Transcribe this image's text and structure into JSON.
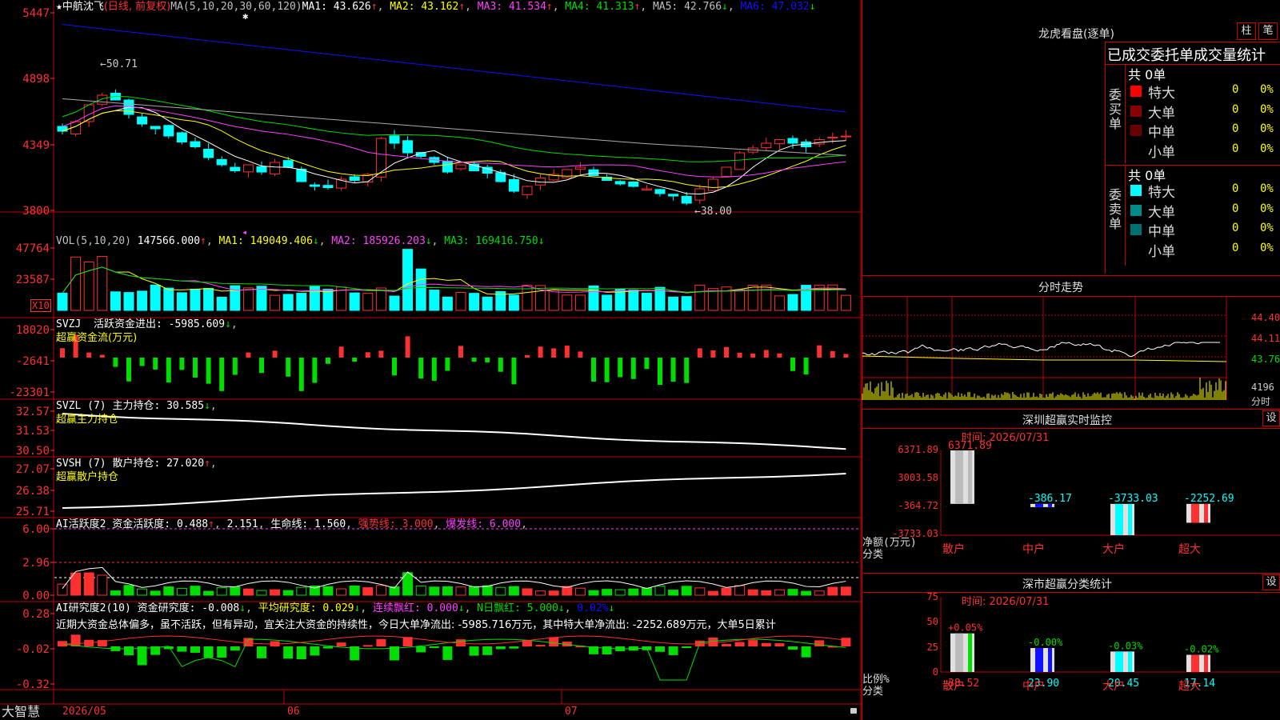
{
  "app": {
    "brand": "大智慧",
    "star": "★",
    "stock_name": "中航沈飞",
    "period_note": "(日线, 前复权)",
    "lock_icon": "lock-icon"
  },
  "colors": {
    "up": "#ff3030",
    "down": "#00ffff",
    "green": "#00dd00",
    "white": "#ffffff",
    "yellow": "#ffff00",
    "magenta": "#ff40ff",
    "blue": "#1010ff",
    "grid": "#c00000"
  },
  "kline": {
    "header_parts": [
      {
        "t": "MA(5,10,20,30,60,120)",
        "c": "#c0c0c0"
      },
      {
        "t": "MA1: 43.626",
        "c": "#ffffff"
      },
      {
        "t": "↑",
        "c": "#ff3030"
      },
      {
        "t": ", ",
        "c": "#c0c0c0"
      },
      {
        "t": "MA2: 43.162",
        "c": "#ffff00"
      },
      {
        "t": "↑",
        "c": "#ff3030"
      },
      {
        "t": ", ",
        "c": "#c0c0c0"
      },
      {
        "t": "MA3: 41.534",
        "c": "#ff40ff"
      },
      {
        "t": "↑",
        "c": "#ff3030"
      },
      {
        "t": ", ",
        "c": "#c0c0c0"
      },
      {
        "t": "MA4: 41.313",
        "c": "#00dd00"
      },
      {
        "t": "↑",
        "c": "#ff3030"
      },
      {
        "t": ", ",
        "c": "#c0c0c0"
      },
      {
        "t": "MA5: 42.766",
        "c": "#c0c0c0"
      },
      {
        "t": "↓",
        "c": "#00dd00"
      },
      {
        "t": ", ",
        "c": "#c0c0c0"
      },
      {
        "t": "MA6: 47.032",
        "c": "#1010ff"
      },
      {
        "t": "↓",
        "c": "#00dd00"
      }
    ],
    "y_ticks": [
      "5447",
      "4898",
      "4349",
      "3800"
    ],
    "high_label": "←50.71",
    "low_label": "←38.00",
    "highlight_marker": "✱",
    "tri_marker": "◂"
  },
  "x_axis": {
    "labels": [
      "2026/05",
      "06",
      "07"
    ]
  },
  "vol": {
    "header_parts": [
      {
        "t": "VOL(5,10,20) ",
        "c": "#c0c0c0"
      },
      {
        "t": "147566.000",
        "c": "#ffffff"
      },
      {
        "t": "↑",
        "c": "#ff3030"
      },
      {
        "t": ", ",
        "c": "#c0c0c0"
      },
      {
        "t": "MA1: 149049.406",
        "c": "#ffff00"
      },
      {
        "t": "↓",
        "c": "#00dd00"
      },
      {
        "t": ", ",
        "c": "#c0c0c0"
      },
      {
        "t": "MA2: 185926.203",
        "c": "#ff40ff"
      },
      {
        "t": "↓",
        "c": "#00dd00"
      },
      {
        "t": ", ",
        "c": "#c0c0c0"
      },
      {
        "t": "MA3: 169416.750",
        "c": "#00dd00"
      },
      {
        "t": "↓",
        "c": "#00dd00"
      }
    ],
    "y_ticks": [
      "47764",
      "23587"
    ],
    "unit": "X10"
  },
  "svzj": {
    "header_parts": [
      {
        "t": "SVZJ  活跃资金进出: -5985.609",
        "c": "#ffffff"
      },
      {
        "t": "↓",
        "c": "#00dd00"
      },
      {
        "t": ",",
        "c": "#c0c0c0"
      }
    ],
    "sub": "超赢资金流(万元)",
    "y_ticks": [
      "18020",
      "-2641",
      "-23301"
    ]
  },
  "svzl": {
    "header_parts": [
      {
        "t": "SVZL (7) 主力持仓: 30.585",
        "c": "#ffffff"
      },
      {
        "t": "↓",
        "c": "#00dd00"
      },
      {
        "t": ",",
        "c": "#c0c0c0"
      }
    ],
    "sub": "超赢主力持仓",
    "y_ticks": [
      "32.57",
      "31.53",
      "30.50"
    ]
  },
  "svsh": {
    "header_parts": [
      {
        "t": "SVSH (7) 散户持仓: 27.020",
        "c": "#ffffff"
      },
      {
        "t": "↑",
        "c": "#ff3030"
      },
      {
        "t": ",",
        "c": "#c0c0c0"
      }
    ],
    "sub": "超赢散户持仓",
    "y_ticks": [
      "27.07",
      "26.38",
      "25.71"
    ]
  },
  "ai_active": {
    "header_parts": [
      {
        "t": "AI活跃度2 资金活跃度: 0.488",
        "c": "#ffffff"
      },
      {
        "t": "↑",
        "c": "#ff3030"
      },
      {
        "t": ", ",
        "c": "#c0c0c0"
      },
      {
        "t": "2.151",
        "c": "#ffffff"
      },
      {
        "t": ", ",
        "c": "#c0c0c0"
      },
      {
        "t": "生命线: 1.560",
        "c": "#ffffff"
      },
      {
        "t": ", ",
        "c": "#c0c0c0"
      },
      {
        "t": "强势线: 3.000",
        "c": "#ff3030"
      },
      {
        "t": ", ",
        "c": "#c0c0c0"
      },
      {
        "t": "爆发线: 6.000",
        "c": "#ff40ff"
      },
      {
        "t": ",",
        "c": "#c0c0c0"
      }
    ],
    "y_ticks": [
      "6.00",
      "2.96",
      "0.00"
    ]
  },
  "ai_research": {
    "header_parts": [
      {
        "t": "AI研究度2(10) 资金研究度: -0.008",
        "c": "#ffffff"
      },
      {
        "t": "↓",
        "c": "#00dd00"
      },
      {
        "t": ", ",
        "c": "#c0c0c0"
      },
      {
        "t": "平均研究度: 0.029",
        "c": "#ffff00"
      },
      {
        "t": "↓",
        "c": "#00dd00"
      },
      {
        "t": ", ",
        "c": "#c0c0c0"
      },
      {
        "t": "连续飘红: 0.000",
        "c": "#ff40ff"
      },
      {
        "t": "↓",
        "c": "#00dd00"
      },
      {
        "t": ", ",
        "c": "#c0c0c0"
      },
      {
        "t": "N日飘红: 5.000",
        "c": "#00dd00"
      },
      {
        "t": "↓",
        "c": "#00dd00"
      },
      {
        "t": ", ",
        "c": "#c0c0c0"
      },
      {
        "t": "0.02%",
        "c": "#1010ff"
      },
      {
        "t": "↓",
        "c": "#00dd00"
      }
    ],
    "comment": "近期大资金总体偏多，虽不活跃，但有异动，宜关注大资金的持续性，今日大单净流出: -5985.716万元，其中特大单净流出: -2252.689万元，大单5日累计",
    "y_ticks": [
      "0.28",
      "-0.02",
      "-0.32"
    ]
  },
  "dragon": {
    "title": "龙虎看盘(逐单)",
    "btn1": "柱",
    "btn2": "笔",
    "subtitle": "已成交委托单成交量统计",
    "buy_label": "委买单",
    "sell_label": "委卖单",
    "buy_total": "共 0单",
    "sell_total": "共 0单",
    "buy_rows": [
      {
        "name": "特大",
        "count": "0",
        "pct": "0%",
        "color": "#ff0000"
      },
      {
        "name": "大单",
        "count": "0",
        "pct": "0%",
        "color": "#8b0000"
      },
      {
        "name": "中单",
        "count": "0",
        "pct": "0%",
        "color": "#6b0000"
      },
      {
        "name": "小单",
        "count": "0",
        "pct": "0%",
        "color": "#000000"
      }
    ],
    "sell_rows": [
      {
        "name": "特大",
        "count": "0",
        "pct": "0%",
        "color": "#00ffff"
      },
      {
        "name": "大单",
        "count": "0",
        "pct": "0%",
        "color": "#008b8b"
      },
      {
        "name": "中单",
        "count": "0",
        "pct": "0%",
        "color": "#007070"
      },
      {
        "name": "小单",
        "count": "0",
        "pct": "0%",
        "color": "#000000"
      }
    ]
  },
  "intraday": {
    "title": "分时走势",
    "y_ticks": [
      "44.40",
      "44.11",
      "43.76"
    ],
    "vol_label": "4196",
    "unit": "分时"
  },
  "monitor": {
    "title": "深圳超赢实时监控",
    "btn": "设",
    "time": "时间: 2026/07/31",
    "y_ticks": [
      "6371.89",
      "3003.58",
      "-364.72",
      "-3733.03"
    ],
    "y_caption": "净额(万元)",
    "x_caption": "分类",
    "bars": [
      {
        "cat": "散户",
        "value": 6371.89,
        "label": "6371.89"
      },
      {
        "cat": "中户",
        "value": -386.17,
        "label": "-386.17"
      },
      {
        "cat": "大户",
        "value": -3733.03,
        "label": "-3733.03"
      },
      {
        "cat": "超大",
        "value": -2252.69,
        "label": "-2252.69"
      }
    ]
  },
  "classify": {
    "title": "深市超赢分类统计",
    "btn": "设",
    "time": "时间: 2026/07/31",
    "y_ticks": [
      "75",
      "50",
      "25",
      "0"
    ],
    "y_caption": "比例%",
    "x_caption": "分类",
    "bars": [
      {
        "cat": "散户",
        "value": 38.52,
        "label": "38.52",
        "change": "+0.05%"
      },
      {
        "cat": "中户",
        "value": 23.9,
        "label": "23.90",
        "change": "-0.00%"
      },
      {
        "cat": "大户",
        "value": 20.45,
        "label": "20.45",
        "change": "-0.03%"
      },
      {
        "cat": "超大",
        "value": 17.14,
        "label": "17.14",
        "change": "-0.02%"
      }
    ]
  },
  "chart_data": [
    {
      "type": "bar",
      "title": "深圳超赢实时监控",
      "ylabel": "净额(万元)",
      "xlabel": "分类",
      "categories": [
        "散户",
        "中户",
        "大户",
        "超大"
      ],
      "values": [
        6371.89,
        -386.17,
        -3733.03,
        -2252.69
      ],
      "ylim": [
        -3733.03,
        6371.89
      ]
    },
    {
      "type": "bar",
      "title": "深市超赢分类统计",
      "ylabel": "比例%",
      "xlabel": "分类",
      "categories": [
        "散户",
        "中户",
        "大户",
        "超大"
      ],
      "values": [
        38.52,
        23.9,
        20.45,
        17.14
      ],
      "ylim": [
        0,
        75
      ]
    }
  ]
}
